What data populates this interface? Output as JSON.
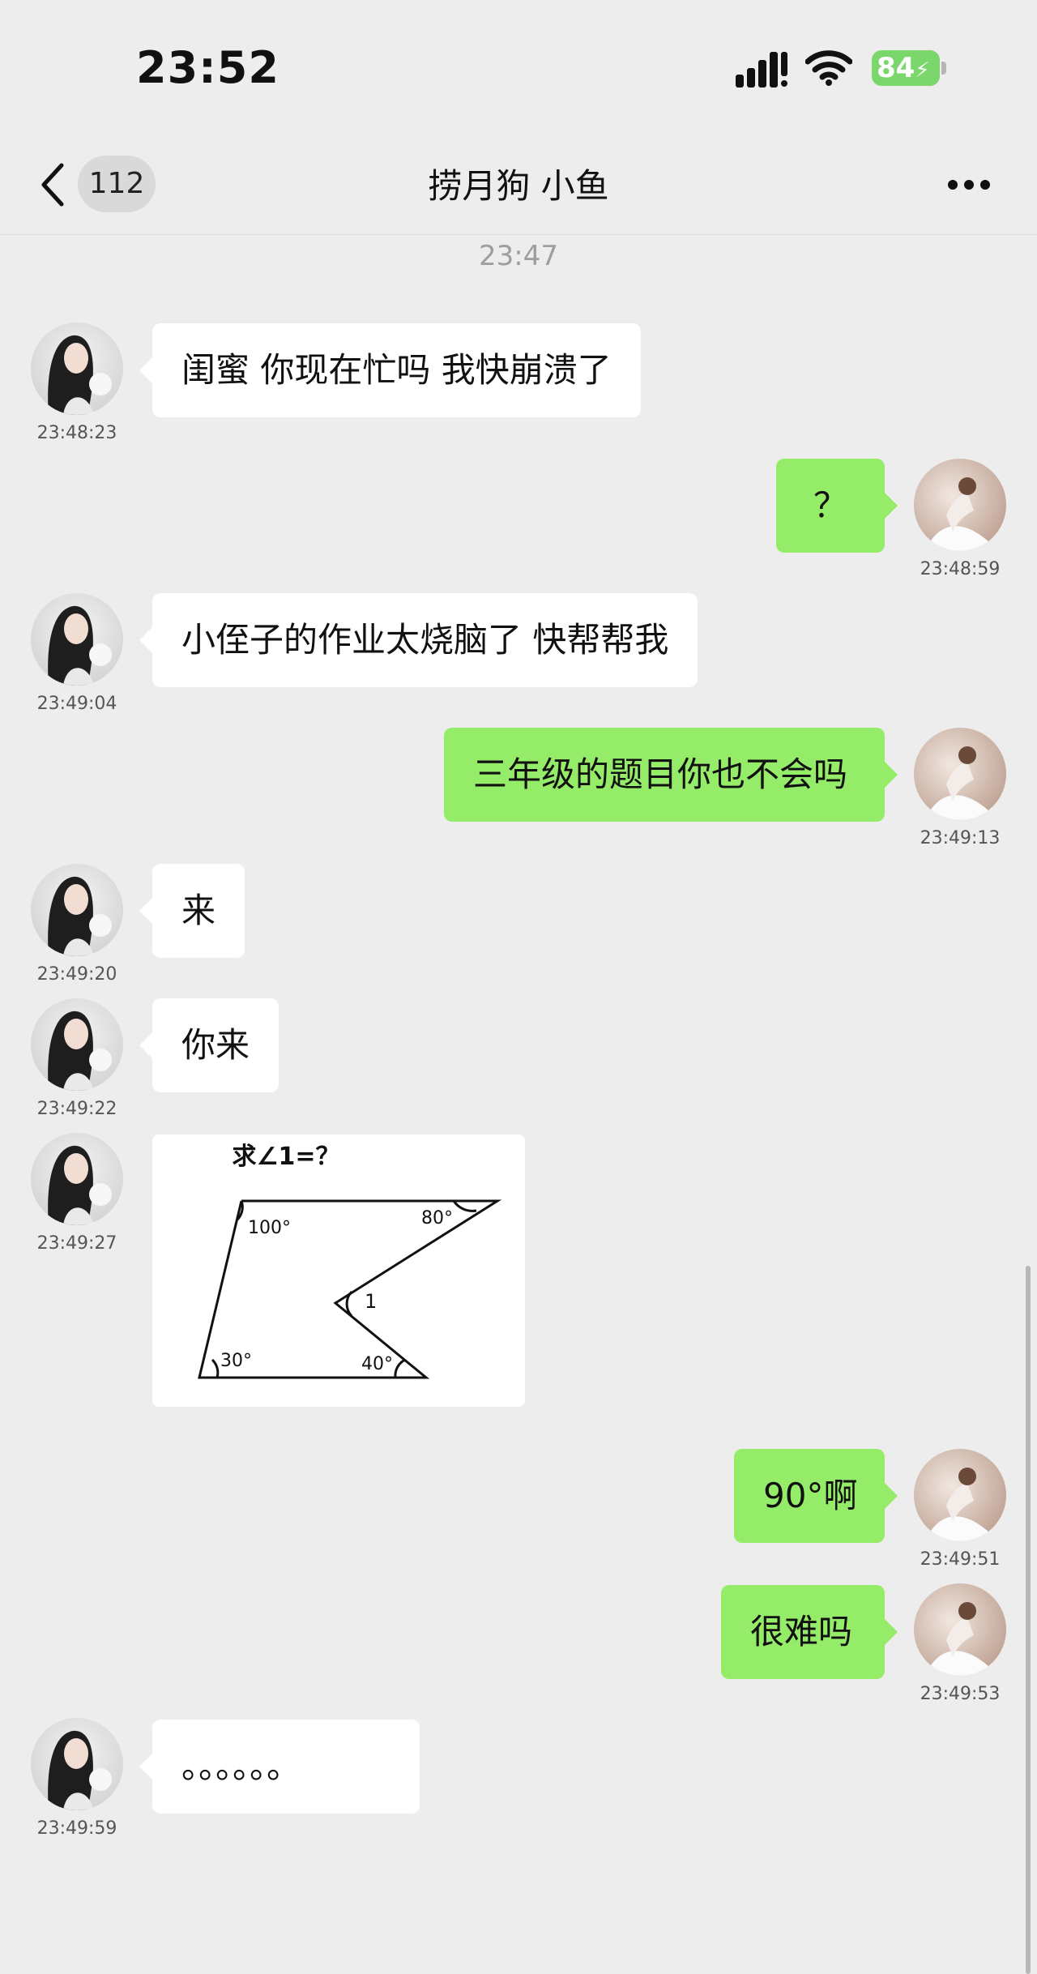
{
  "status_bar": {
    "time": "23:52",
    "battery": "84"
  },
  "nav": {
    "unread_count": "112",
    "title": "捞月狗 小鱼"
  },
  "time_divider": "23:47",
  "messages": [
    {
      "side": "in",
      "text": "闺蜜  你现在忙吗  我快崩溃了",
      "time": "23:48:23"
    },
    {
      "side": "out",
      "text": "？",
      "time": "23:48:59"
    },
    {
      "side": "in",
      "text": "小侄子的作业太烧脑了  快帮帮我",
      "time": "23:49:04"
    },
    {
      "side": "out",
      "text": "三年级的题目你也不会吗",
      "time": "23:49:13"
    },
    {
      "side": "in",
      "text": "来",
      "time": "23:49:20"
    },
    {
      "side": "in",
      "text": "你来",
      "time": "23:49:22"
    },
    {
      "side": "in",
      "type": "image",
      "time": "23:49:27",
      "image": {
        "caption": "求∠1=？",
        "angle_labels": [
          "100°",
          "80°",
          "1",
          "30°",
          "40°"
        ]
      }
    },
    {
      "side": "out",
      "text": "90°啊",
      "time": "23:49:51"
    },
    {
      "side": "out",
      "text": "很难吗",
      "time": "23:49:53"
    },
    {
      "side": "in",
      "text": "。。。。。。",
      "time": "23:49:59"
    }
  ],
  "colors": {
    "background": "#ededed",
    "incoming_bubble": "#ffffff",
    "outgoing_bubble": "#95ec69",
    "battery": "#7bd66b"
  }
}
